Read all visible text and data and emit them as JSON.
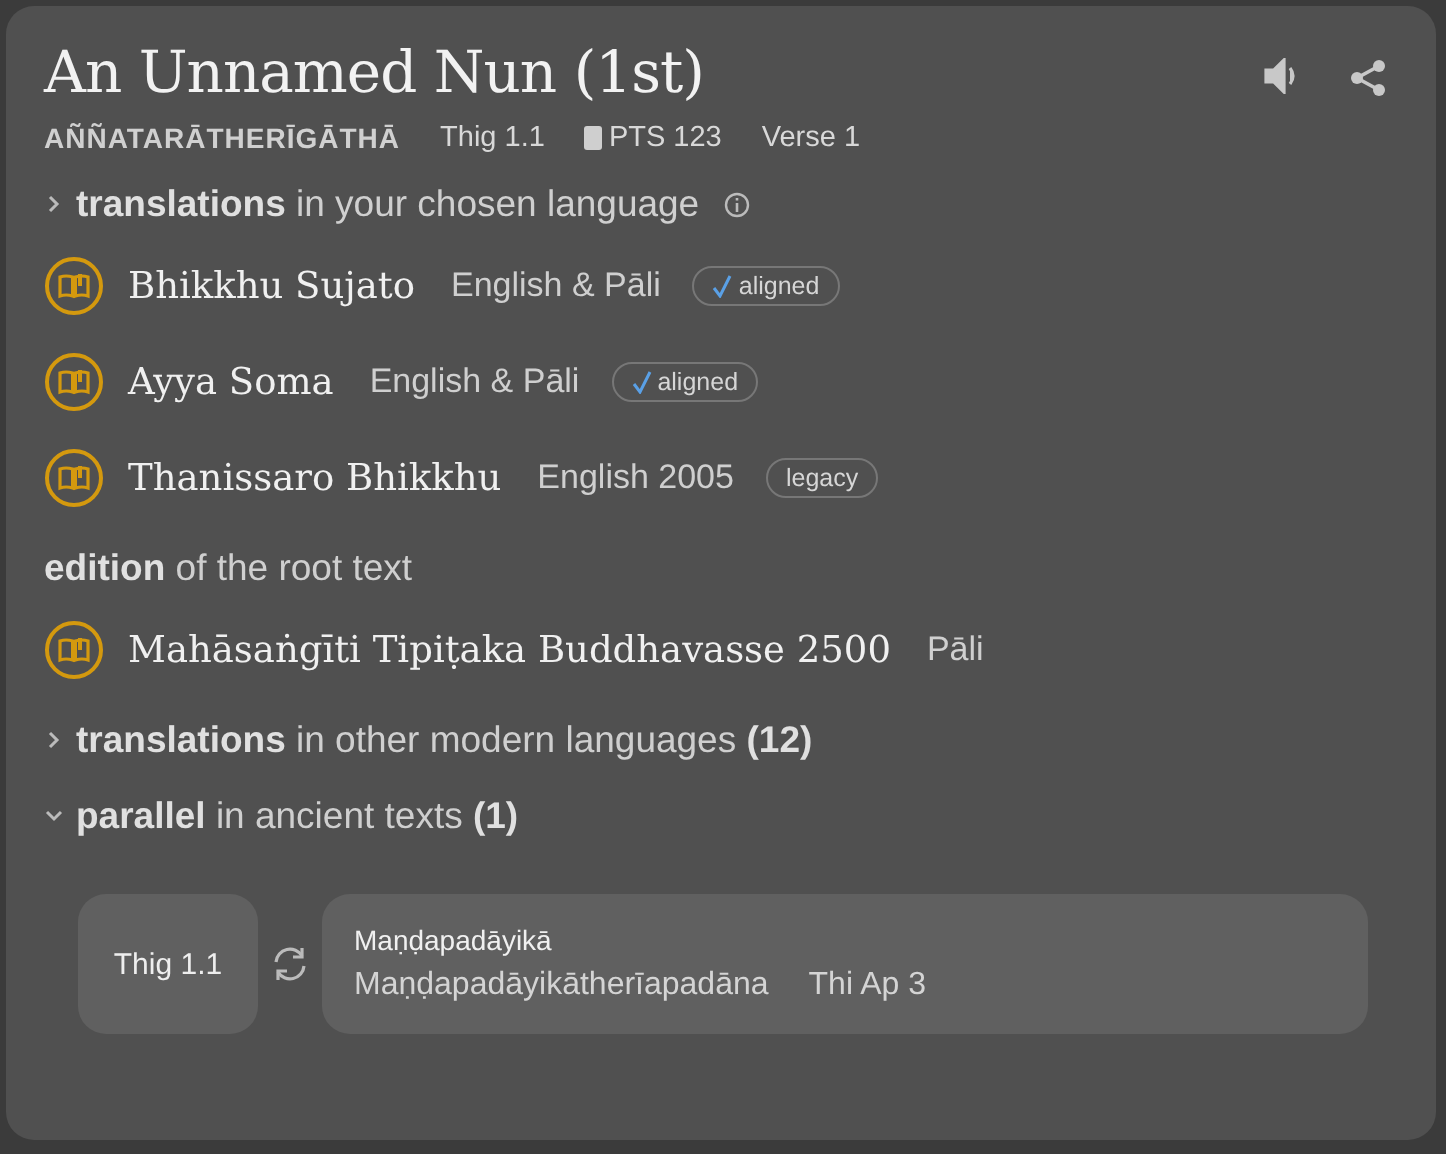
{
  "title": "An Unnamed Nun (1st)",
  "meta": {
    "root_title": "AÑÑATARĀTHERĪGĀTHĀ",
    "uid": "Thig 1.1",
    "pts": "PTS 123",
    "verse": "Verse 1"
  },
  "blocks": [
    {
      "kind": "toggle",
      "strong": "translations",
      "text": "in your chosen language",
      "info": true,
      "expanded": false
    },
    {
      "kind": "work",
      "name": "Bhikkhu Sujato",
      "lang": "English & Pāli",
      "badge": {
        "label": "aligned",
        "checked": true
      }
    },
    {
      "kind": "work",
      "name": "Ayya Soma",
      "lang": "English & Pāli",
      "badge": {
        "label": "aligned",
        "checked": true
      }
    },
    {
      "kind": "work",
      "name": "Thanissaro Bhikkhu",
      "lang": "English 2005",
      "badge": {
        "label": "legacy",
        "checked": false
      }
    },
    {
      "kind": "heading",
      "strong": "edition",
      "text": "of the root text"
    },
    {
      "kind": "work",
      "name": "Mahāsaṅgīti Tipiṭaka Buddhavasse 2500",
      "lang": "Pāli"
    },
    {
      "kind": "toggle",
      "strong": "translations",
      "text": "in other modern languages",
      "count": "(12)",
      "expanded": false
    },
    {
      "kind": "toggle",
      "strong": "parallel",
      "text": "in ancient texts",
      "count": "(1)",
      "expanded": true
    },
    {
      "kind": "parallel",
      "source": "Thig 1.1",
      "title": "Maṇḍapadāyikā",
      "subtitle": "Maṇḍapadāyikātherīapadāna",
      "ref": "Thi Ap 3"
    }
  ]
}
